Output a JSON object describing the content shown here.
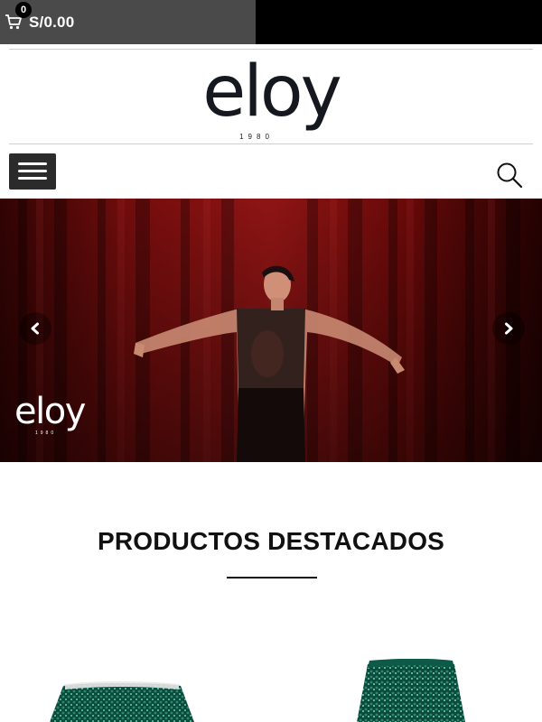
{
  "header": {
    "cart_count": "0",
    "cart_total": "S/0.00"
  },
  "brand": {
    "name": "eloy",
    "year": "1980"
  },
  "hero": {
    "logo_name": "eloy",
    "logo_year": "1980"
  },
  "featured": {
    "title": "PRODUCTOS DESTACADOS"
  },
  "icons": {
    "cart": "cart-icon",
    "menu": "hamburger-menu-icon",
    "search": "search-icon",
    "prev": "chevron-left-icon",
    "next": "chevron-right-icon"
  },
  "colors": {
    "topbar": "#000000",
    "cart_area": "#4a4a4a",
    "menu_button": "#2b2b2b",
    "curtain_red": "#8a0f0f",
    "sequin_green": "#0f5a4a"
  }
}
